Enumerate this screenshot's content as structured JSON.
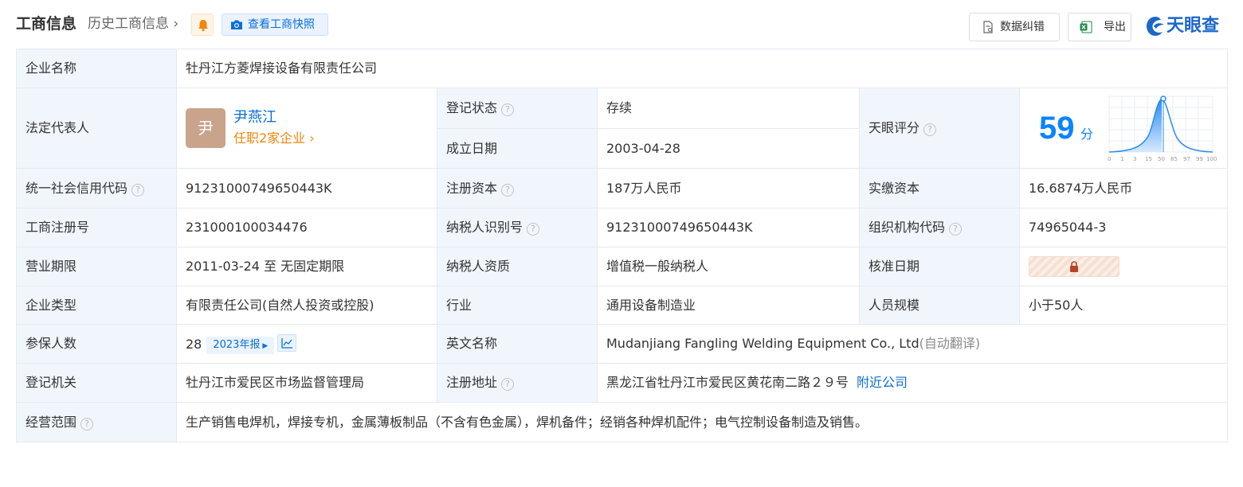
{
  "header": {
    "title": "工商信息",
    "history": "历史工商信息",
    "snapshot": "查看工商快照",
    "correct": "数据纠错",
    "export": "导出",
    "logo": "天眼查"
  },
  "company": {
    "name_label": "企业名称",
    "name": "牡丹江方菱焊接设备有限责任公司",
    "legal_label": "法定代表人",
    "legal_avatar": "尹",
    "legal_name": "尹燕江",
    "legal_positions": "任职2家企业",
    "reg_status_label": "登记状态",
    "reg_status": "存续",
    "found_label": "成立日期",
    "found_date": "2003-04-28",
    "score_label": "天眼评分",
    "score": "59",
    "score_unit": "分",
    "score_axis": [
      "0",
      "1",
      "3",
      "15",
      "50",
      "85",
      "97",
      "99",
      "100"
    ],
    "credit_label": "统一社会信用代码",
    "credit_code": "91231000749650443K",
    "reg_capital_label": "注册资本",
    "reg_capital": "187万人民币",
    "paid_capital_label": "实缴资本",
    "paid_capital": "16.6874万人民币",
    "biz_reg_label": "工商注册号",
    "biz_reg_no": "231000100034476",
    "tax_id_label": "纳税人识别号",
    "tax_id": "91231000749650443K",
    "org_code_label": "组织机构代码",
    "org_code": "74965044-3",
    "term_label": "营业期限",
    "term": "2011-03-24 至 无固定期限",
    "tax_qual_label": "纳税人资质",
    "tax_qual": "增值税一般纳税人",
    "approve_label": "核准日期",
    "type_label": "企业类型",
    "type": "有限责任公司(自然人投资或控股)",
    "industry_label": "行业",
    "industry": "通用设备制造业",
    "staff_label": "人员规模",
    "staff": "小于50人",
    "insured_label": "参保人数",
    "insured": "28",
    "insured_report": "2023年报",
    "en_label": "英文名称",
    "en_name": "Mudanjiang Fangling Welding Equipment Co., Ltd",
    "en_note": "(自动翻译)",
    "authority_label": "登记机关",
    "authority": "牡丹江市爱民区市场监督管理局",
    "address_label": "注册地址",
    "address": "黑龙江省牡丹江市爱民区黄花南二路２９号",
    "nearby": "附近公司",
    "scope_label": "经营范围",
    "scope": "生产销售电焊机，焊接专机，金属薄板制品（不含有色金属），焊机备件；经销各种焊机配件；电气控制设备制造及销售。"
  },
  "colors": {
    "accent": "#0a6fd6",
    "status_green": "#1e9f3a",
    "label_bg": "#f1f6fc",
    "orange": "#f2850d"
  }
}
